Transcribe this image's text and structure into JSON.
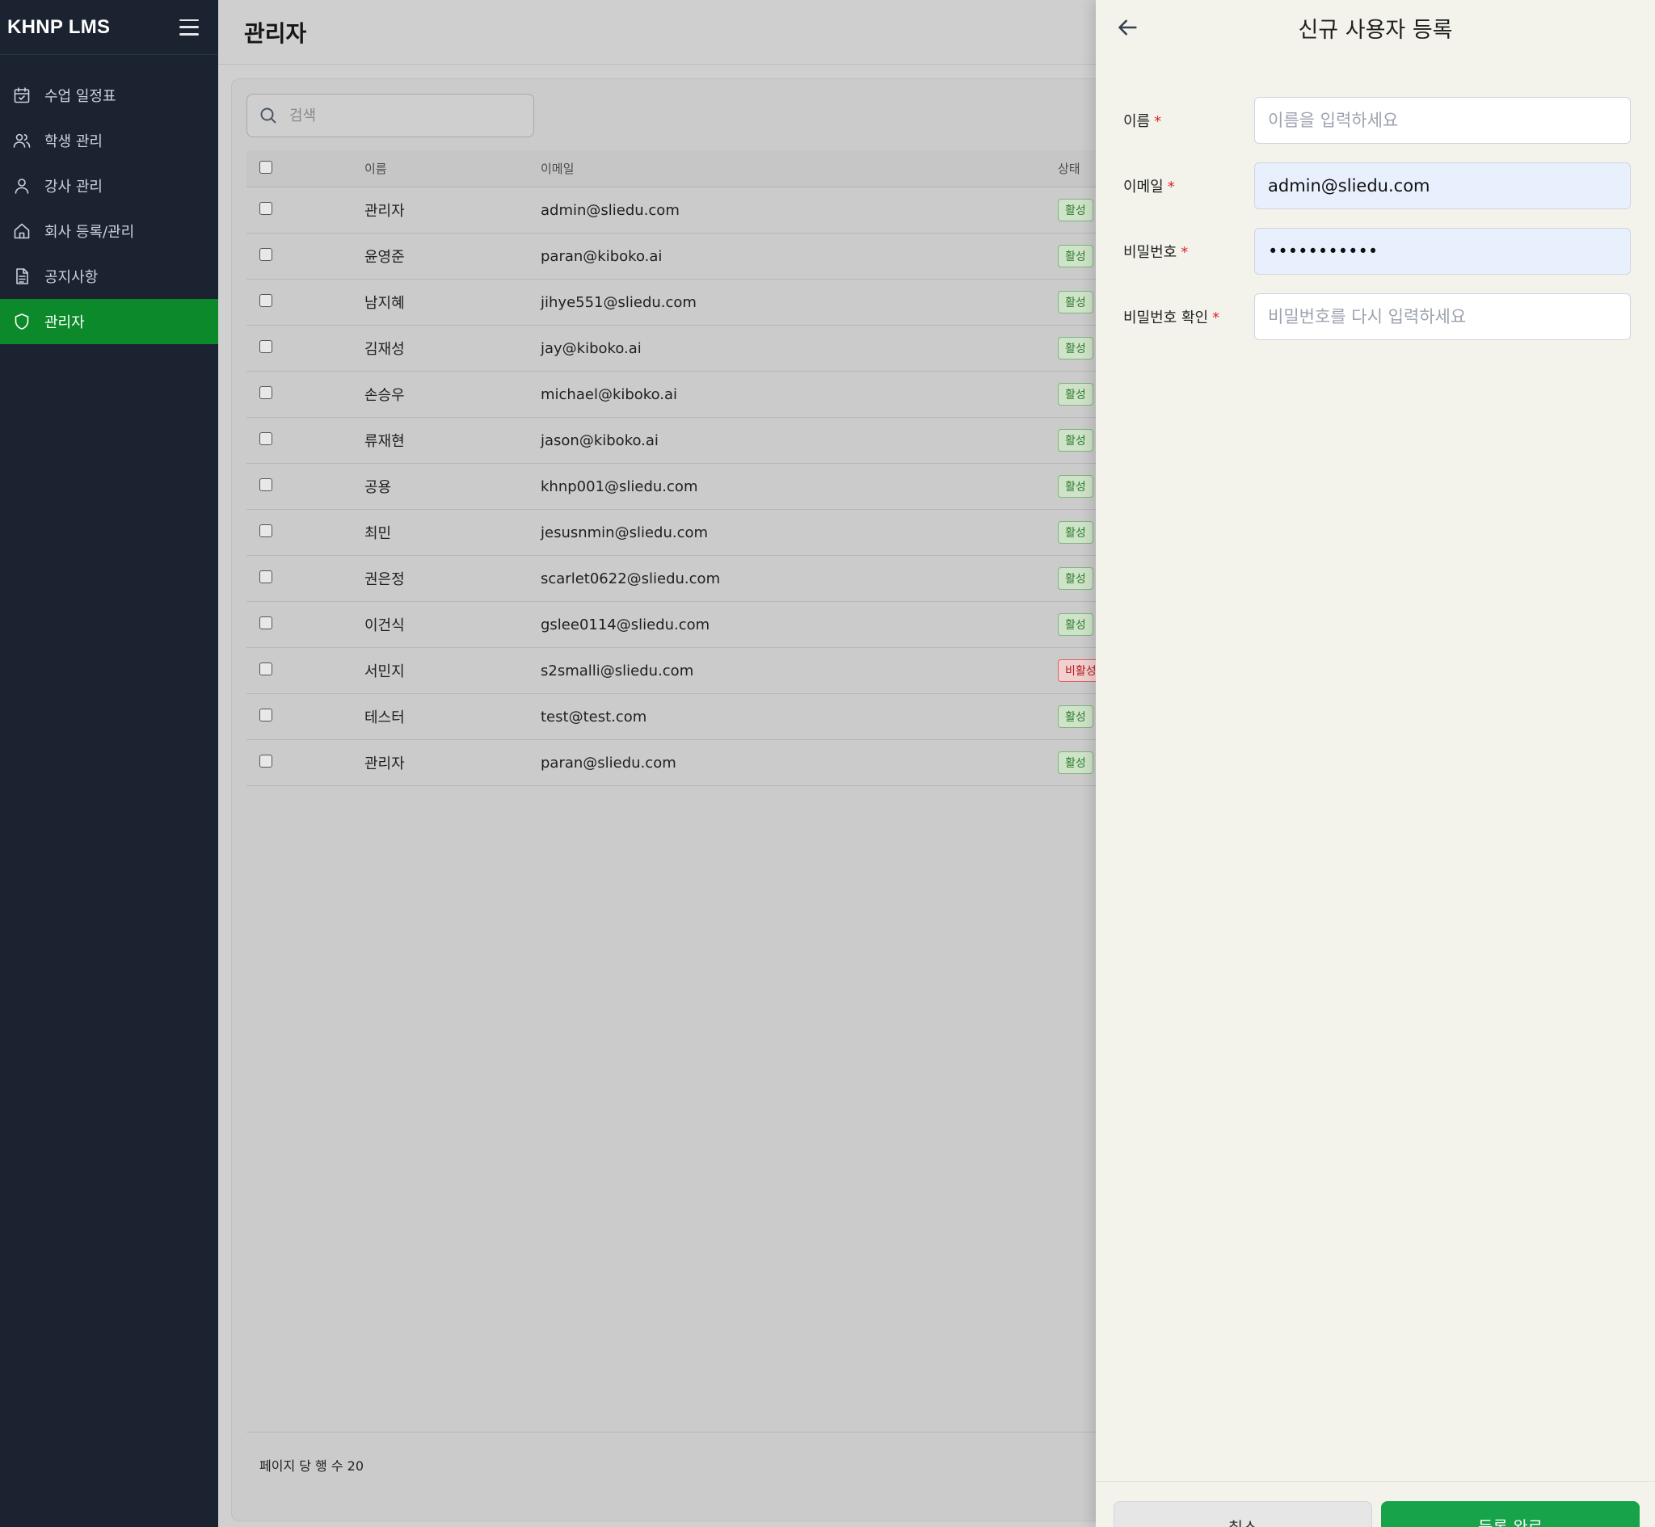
{
  "sidebar": {
    "brand": "KHNP LMS",
    "items": [
      {
        "label": "수업 일정표",
        "icon": "calendar-check-icon",
        "active": false
      },
      {
        "label": "학생 관리",
        "icon": "users-icon",
        "active": false
      },
      {
        "label": "강사 관리",
        "icon": "user-icon",
        "active": false
      },
      {
        "label": "회사 등록/관리",
        "icon": "home-icon",
        "active": false
      },
      {
        "label": "공지사항",
        "icon": "document-icon",
        "active": false
      },
      {
        "label": "관리자",
        "icon": "shield-icon",
        "active": true
      }
    ]
  },
  "header": {
    "title": "관리자"
  },
  "search": {
    "placeholder": "검색"
  },
  "table": {
    "columns": {
      "name": "이름",
      "email": "이메일",
      "status": "상태"
    },
    "rows": [
      {
        "name": "관리자",
        "email": "admin@sliedu.com",
        "status": "활성"
      },
      {
        "name": "윤영준",
        "email": "paran@kiboko.ai",
        "status": "활성"
      },
      {
        "name": "남지혜",
        "email": "jihye551@sliedu.com",
        "status": "활성"
      },
      {
        "name": "김재성",
        "email": "jay@kiboko.ai",
        "status": "활성"
      },
      {
        "name": "손승우",
        "email": "michael@kiboko.ai",
        "status": "활성"
      },
      {
        "name": "류재현",
        "email": "jason@kiboko.ai",
        "status": "활성"
      },
      {
        "name": "공용",
        "email": "khnp001@sliedu.com",
        "status": "활성"
      },
      {
        "name": "최민",
        "email": "jesusnmin@sliedu.com",
        "status": "활성"
      },
      {
        "name": "권은정",
        "email": "scarlet0622@sliedu.com",
        "status": "활성"
      },
      {
        "name": "이건식",
        "email": "gslee0114@sliedu.com",
        "status": "활성"
      },
      {
        "name": "서민지",
        "email": "s2smalli@sliedu.com",
        "status": "비활성"
      },
      {
        "name": "테스터",
        "email": "test@test.com",
        "status": "활성"
      },
      {
        "name": "관리자",
        "email": "paran@sliedu.com",
        "status": "활성"
      }
    ],
    "footer": "페이지 당 행 수 20"
  },
  "drawer": {
    "title": "신규 사용자 등록",
    "fields": [
      {
        "label": "이름",
        "required": "*",
        "value": "",
        "placeholder": "이름을 입력하세요"
      },
      {
        "label": "이메일",
        "required": "*",
        "value": "admin@sliedu.com",
        "placeholder": ""
      },
      {
        "label": "비밀번호",
        "required": "*",
        "value": "•••••••••••",
        "placeholder": ""
      },
      {
        "label": "비밀번호 확인",
        "required": "*",
        "value": "",
        "placeholder": "비밀번호를 다시 입력하세요"
      }
    ],
    "cancel_label": "취소",
    "submit_label": "등록 완료"
  },
  "colors": {
    "sidebar_bg": "#1b2330",
    "active_green": "#0c8a2b",
    "submit_green": "#16a34a",
    "required_red": "#dc2626"
  }
}
